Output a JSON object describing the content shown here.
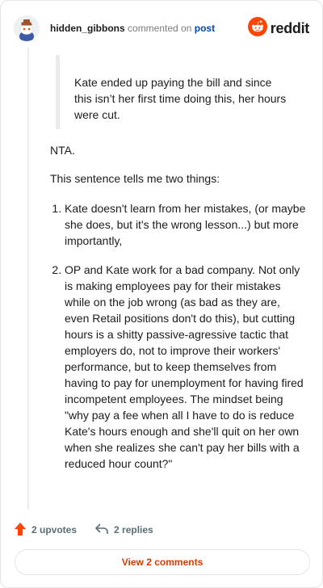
{
  "header": {
    "username": "hidden_gibbons",
    "action_text": "commented on",
    "post_link": "post",
    "brand": "reddit"
  },
  "comment": {
    "quote": "Kate ended up paying the bill and since this isn’t her first time doing this, her hours were cut.",
    "paragraphs": [
      "NTA.",
      "This sentence tells me two things:"
    ],
    "points": [
      "Kate doesn't learn from her mistakes, (or maybe she does, but it's the wrong lesson...) but more importantly,",
      "OP and Kate work for a bad company. Not only is making employees pay for their mistakes while on the job wrong (as bad as they are, even Retail positions don't do this), but cutting hours is a shitty passive-agressive tactic that employers do, not to improve their workers' performance, but to keep themselves from having to pay for unemployment for having fired incompetent employees. The mindset being \"why pay a fee when all I have to do is reduce Kate's hours enough and she'll quit on her own when she realizes she can't pay her bills with a reduced hour count?\""
    ]
  },
  "actions": {
    "upvotes": "2 upvotes",
    "replies": "2 replies"
  },
  "view_button": "View 2 comments",
  "colors": {
    "brand_orange": "#ff4500",
    "link_blue": "#0045ac",
    "view_orange": "#d93a00",
    "meta_gray": "#7c7c7c",
    "action_gray": "#576f76"
  },
  "icons": {
    "avatar": "snoo-avatar-icon",
    "brand": "reddit-logo-icon",
    "upvote": "upvote-arrow-icon",
    "reply": "reply-arrow-icon"
  }
}
